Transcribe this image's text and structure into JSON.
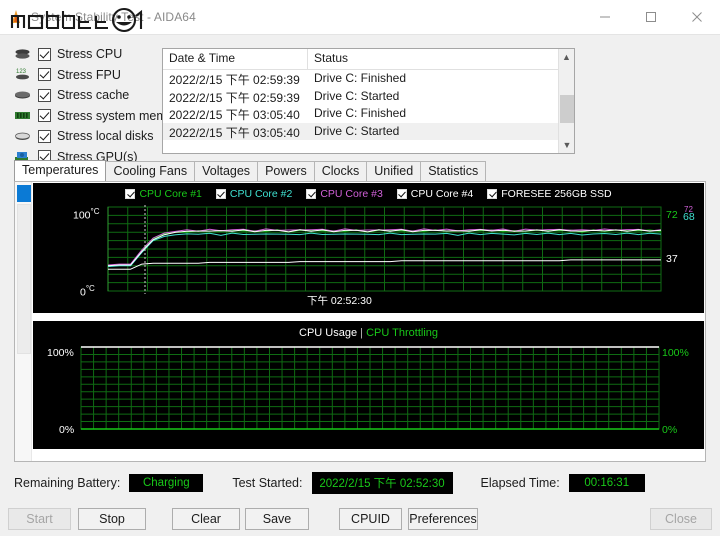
{
  "window": {
    "title": "System Stability Test - AIDA64",
    "icon": "flame-icon",
    "minimize_label": "minimize-icon",
    "maximize_label": "maximize-icon",
    "close_label": "close-icon"
  },
  "watermark": {
    "text": "mobile01"
  },
  "stress_options": [
    {
      "label": "Stress CPU",
      "checked": true,
      "icon": "cpu-icon"
    },
    {
      "label": "Stress FPU",
      "checked": true,
      "icon": "fpu-icon"
    },
    {
      "label": "Stress cache",
      "checked": true,
      "icon": "cache-icon"
    },
    {
      "label": "Stress system memory",
      "checked": true,
      "icon": "memory-icon"
    },
    {
      "label": "Stress local disks",
      "checked": true,
      "icon": "disk-icon"
    },
    {
      "label": "Stress GPU(s)",
      "checked": true,
      "icon": "gpu-icon"
    }
  ],
  "log": {
    "columns": [
      "Date & Time",
      "Status"
    ],
    "rows": [
      {
        "datetime": "2022/2/15 下午 02:59:39",
        "status": "Drive C: Finished"
      },
      {
        "datetime": "2022/2/15 下午 02:59:39",
        "status": "Drive C: Started"
      },
      {
        "datetime": "2022/2/15 下午 03:05:40",
        "status": "Drive C: Finished"
      },
      {
        "datetime": "2022/2/15 下午 03:05:40",
        "status": "Drive C: Started"
      }
    ],
    "scroll_up": "▲",
    "scroll_down": "▼"
  },
  "tabs": [
    {
      "label": "Temperatures",
      "active": true
    },
    {
      "label": "Cooling Fans",
      "active": false
    },
    {
      "label": "Voltages",
      "active": false
    },
    {
      "label": "Powers",
      "active": false
    },
    {
      "label": "Clocks",
      "active": false
    },
    {
      "label": "Unified",
      "active": false
    },
    {
      "label": "Statistics",
      "active": false
    }
  ],
  "chart_data": [
    {
      "type": "line",
      "name": "temperatures",
      "title": "",
      "ylabel_top": "100",
      "ylabel_top_unit": "°C",
      "ylabel_bottom": "0",
      "ylabel_bottom_unit": "°C",
      "ylim": [
        0,
        100
      ],
      "grid": true,
      "xlabel": "下午 02:52:30",
      "legend_position": "top",
      "series": [
        {
          "name": "CPU Core #1",
          "color": "#19c819",
          "checked": true,
          "end_value": 72,
          "values": [
            30,
            31,
            31,
            48,
            62,
            68,
            70,
            71,
            71,
            72,
            71,
            72,
            72,
            71,
            72,
            72,
            71,
            72,
            72,
            72,
            71,
            72,
            72,
            71,
            72,
            72,
            72,
            71,
            72,
            72,
            72,
            71,
            72,
            72,
            72,
            72,
            71,
            72,
            72,
            72,
            72,
            72,
            71,
            72,
            72,
            72,
            72,
            72,
            72,
            72
          ]
        },
        {
          "name": "CPU Core #2",
          "color": "#3fe0d0",
          "checked": true,
          "end_value": 68,
          "values": [
            29,
            30,
            30,
            46,
            60,
            65,
            67,
            68,
            68,
            68,
            67,
            68,
            68,
            67,
            68,
            68,
            67,
            68,
            68,
            68,
            67,
            68,
            68,
            67,
            68,
            68,
            68,
            67,
            68,
            68,
            68,
            67,
            68,
            68,
            68,
            68,
            67,
            68,
            68,
            68,
            68,
            68,
            67,
            68,
            68,
            68,
            68,
            68,
            68,
            68
          ]
        },
        {
          "name": "CPU Core #3",
          "color": "#d060d8",
          "checked": true,
          "end_value": 72,
          "values": [
            31,
            32,
            32,
            49,
            63,
            69,
            71,
            72,
            72,
            73,
            72,
            73,
            73,
            72,
            73,
            73,
            72,
            73,
            73,
            73,
            72,
            73,
            73,
            72,
            73,
            73,
            73,
            72,
            73,
            73,
            73,
            72,
            73,
            73,
            73,
            73,
            72,
            73,
            73,
            73,
            73,
            73,
            72,
            73,
            73,
            73,
            73,
            73,
            72,
            72
          ]
        },
        {
          "name": "CPU Core #4",
          "color": "#ffffff",
          "checked": true,
          "end_value": 72,
          "values": [
            30,
            31,
            31,
            47,
            61,
            67,
            70,
            71,
            71,
            72,
            71,
            72,
            72,
            71,
            72,
            72,
            71,
            72,
            72,
            72,
            71,
            72,
            72,
            71,
            72,
            72,
            72,
            71,
            72,
            72,
            72,
            71,
            72,
            72,
            72,
            72,
            71,
            72,
            72,
            72,
            72,
            72,
            71,
            72,
            72,
            72,
            72,
            72,
            72,
            72
          ]
        },
        {
          "name": "FORESEE 256GB SSD",
          "color": "#ffffff",
          "checked": true,
          "end_value": 37,
          "values": [
            26,
            26,
            26,
            32,
            33,
            33,
            33,
            33,
            33,
            34,
            34,
            34,
            34,
            34,
            34,
            34,
            34,
            35,
            35,
            35,
            35,
            35,
            35,
            35,
            35,
            35,
            36,
            36,
            36,
            36,
            36,
            36,
            36,
            36,
            36,
            36,
            36,
            36,
            36,
            36,
            36,
            37,
            37,
            37,
            37,
            37,
            37,
            37,
            37,
            37
          ]
        }
      ],
      "right_labels": [
        {
          "text": "72",
          "color": "#19c819"
        },
        {
          "text": "72",
          "color": "#d060d8"
        },
        {
          "text": "68",
          "color": "#3fe0d0"
        },
        {
          "text": "37",
          "color": "#ffffff"
        }
      ]
    },
    {
      "type": "line",
      "name": "cpu-usage",
      "title_usage": "CPU Usage",
      "title_separator": "|",
      "title_throttling": "CPU Throttling",
      "ylabel_top_left": "100%",
      "ylabel_bottom_left": "0%",
      "ylabel_top_right": "100%",
      "ylabel_bottom_right": "0%",
      "ylim": [
        0,
        100
      ],
      "grid": true,
      "series": [
        {
          "name": "CPU Usage",
          "color": "#ffffff",
          "values": [
            100,
            100,
            100,
            100,
            100,
            100,
            100,
            100,
            100,
            100,
            100,
            100,
            100,
            100,
            100,
            100,
            100,
            100,
            100,
            100,
            100,
            100,
            100,
            100,
            100,
            100,
            100,
            100,
            100,
            100,
            100,
            100,
            100,
            100,
            100,
            100,
            100,
            100,
            100,
            100,
            100,
            100,
            100,
            100,
            100,
            100,
            100,
            100,
            100,
            100
          ]
        },
        {
          "name": "CPU Throttling",
          "color": "#19c819",
          "values": [
            0,
            0,
            0,
            0,
            0,
            0,
            0,
            0,
            0,
            0,
            0,
            0,
            0,
            0,
            0,
            0,
            0,
            0,
            0,
            0,
            0,
            0,
            0,
            0,
            0,
            0,
            0,
            0,
            0,
            0,
            0,
            0,
            0,
            0,
            0,
            0,
            0,
            0,
            0,
            0,
            0,
            0,
            0,
            0,
            0,
            0,
            0,
            0,
            0,
            0
          ]
        }
      ]
    }
  ],
  "status": {
    "battery_label": "Remaining Battery:",
    "battery_value": "Charging",
    "started_label": "Test Started:",
    "started_value": "2022/2/15 下午 02:52:30",
    "elapsed_label": "Elapsed Time:",
    "elapsed_value": "00:16:31"
  },
  "buttons": [
    {
      "label": "Start",
      "disabled": true
    },
    {
      "label": "Stop",
      "disabled": false
    },
    {
      "label": "Clear",
      "disabled": false
    },
    {
      "label": "Save",
      "disabled": false
    },
    {
      "label": "CPUID",
      "disabled": false
    },
    {
      "label": "Preferences",
      "disabled": false
    },
    {
      "label": "Close",
      "disabled": true
    }
  ]
}
